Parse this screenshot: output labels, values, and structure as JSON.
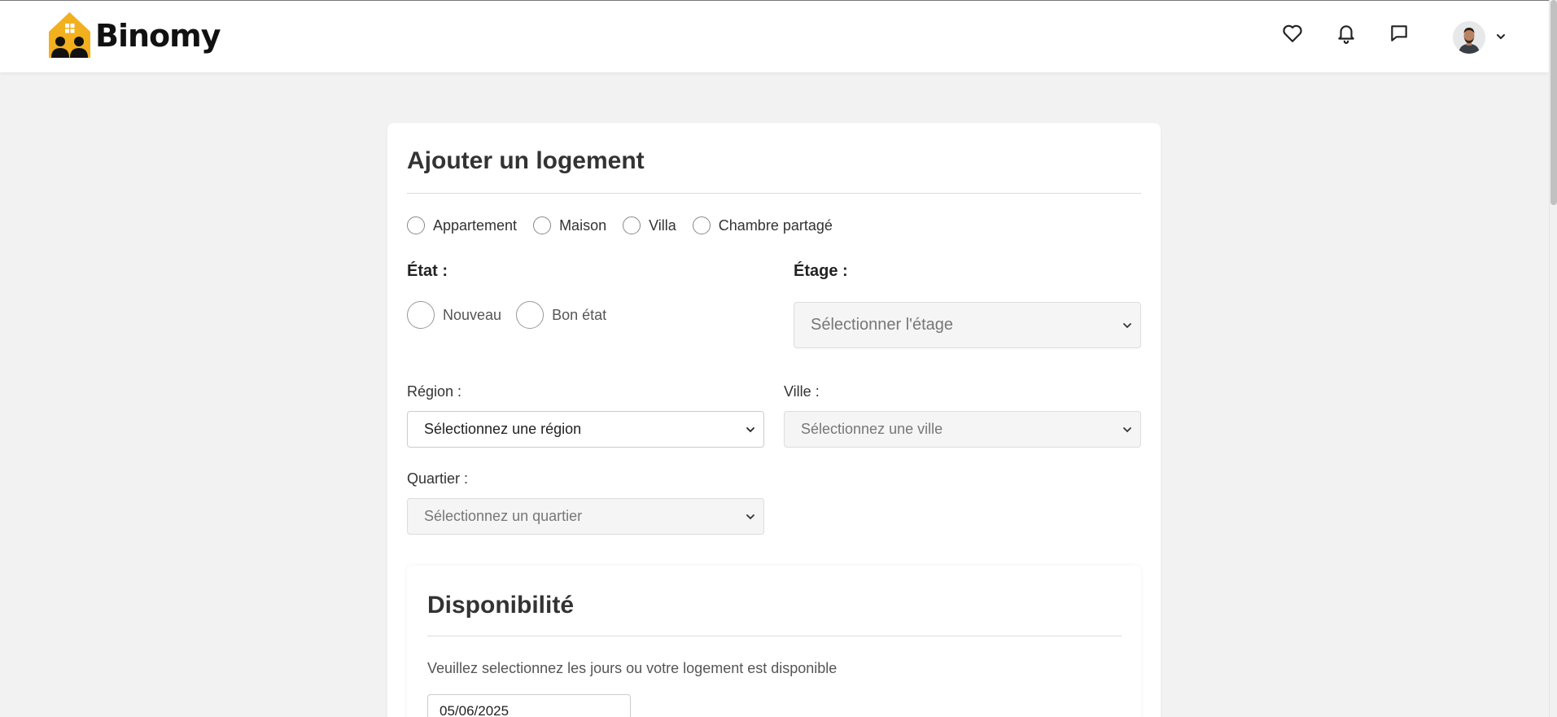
{
  "header": {
    "brand": "Binomy",
    "brand_color": "#f2b01e",
    "icons": [
      "heart-icon",
      "bell-icon",
      "message-icon"
    ]
  },
  "form": {
    "title": "Ajouter un logement",
    "property_types": [
      "Appartement",
      "Maison",
      "Villa",
      "Chambre partagé"
    ],
    "condition": {
      "label": "État :",
      "options": [
        "Nouveau",
        "Bon état"
      ]
    },
    "floor": {
      "label": "Étage :",
      "placeholder": "Sélectionner l'étage"
    },
    "region": {
      "label": "Région :",
      "value": "Sélectionnez une région"
    },
    "city": {
      "label": "Ville :",
      "value": "Sélectionnez une ville"
    },
    "district": {
      "label": "Quartier :",
      "value": "Sélectionnez un quartier"
    }
  },
  "availability": {
    "title": "Disponibilité",
    "instructions": "Veuillez selectionnez les jours ou votre logement est disponible",
    "date": "05/06/2025"
  }
}
